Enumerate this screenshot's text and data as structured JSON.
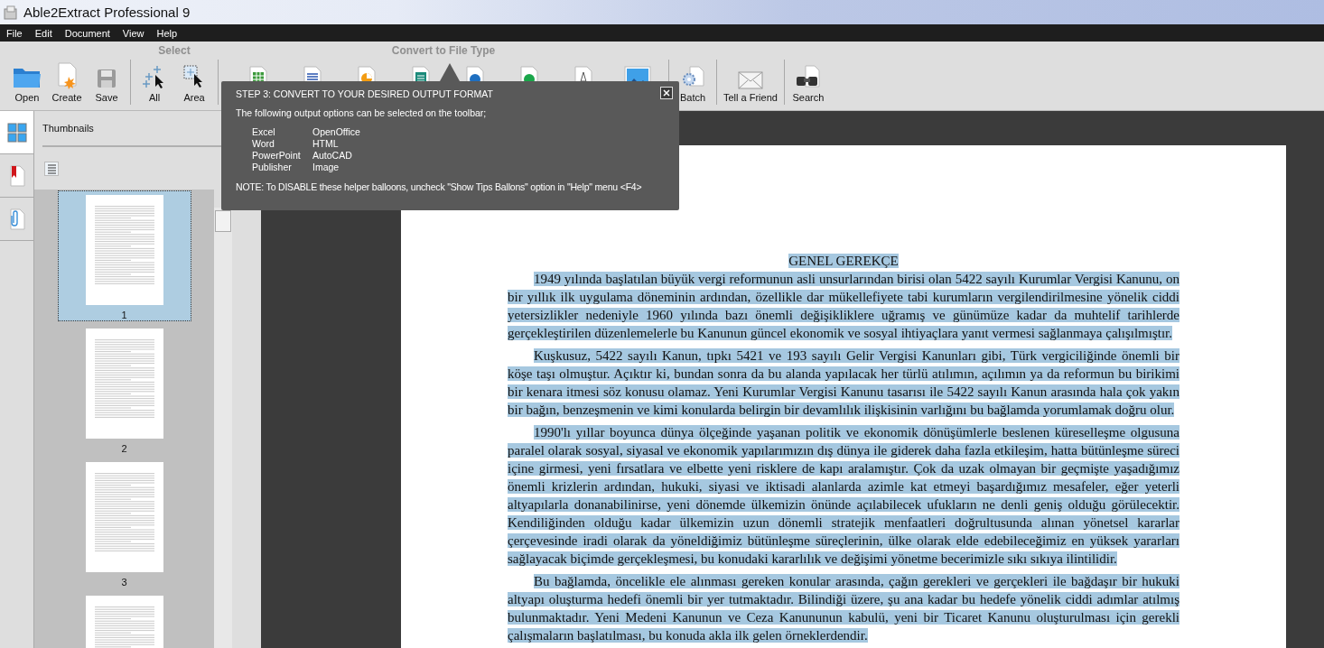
{
  "window": {
    "title": "Able2Extract Professional 9"
  },
  "menu": [
    "File",
    "Edit",
    "Document",
    "View",
    "Help"
  ],
  "toolbar": [
    {
      "buttons": [
        {
          "kind": "folder",
          "label": "Open"
        },
        {
          "kind": "create",
          "label": "Create"
        },
        {
          "kind": "save",
          "label": "Save"
        }
      ]
    },
    {
      "title": "Select",
      "buttons": [
        {
          "kind": "select-all",
          "label": "All"
        },
        {
          "kind": "select-area",
          "label": "Area"
        }
      ]
    },
    {
      "title": "Convert to File Type",
      "buttons": [
        {
          "kind": "sheet"
        },
        {
          "kind": "doc"
        },
        {
          "kind": "pie"
        },
        {
          "kind": "pub"
        },
        {
          "kind": "office"
        },
        {
          "kind": "html"
        },
        {
          "kind": "cad"
        },
        {
          "kind": "image"
        }
      ]
    },
    {
      "buttons": [
        {
          "kind": "batch",
          "label": "Batch"
        }
      ]
    },
    {
      "buttons": [
        {
          "kind": "mail",
          "label": "Tell a Friend"
        }
      ]
    },
    {
      "buttons": [
        {
          "kind": "binoculars",
          "label": "Search"
        }
      ]
    }
  ],
  "side_tabs": [
    {
      "kind": "thumbs",
      "selected": true
    },
    {
      "kind": "bookmark",
      "selected": false
    },
    {
      "kind": "attach",
      "selected": false
    }
  ],
  "thumbnails": {
    "title": "Thumbnails",
    "pages": [
      {
        "label": "1",
        "selected": true
      },
      {
        "label": "2",
        "selected": false
      },
      {
        "label": "3",
        "selected": false
      },
      {
        "selected": false
      }
    ]
  },
  "balloon": {
    "title": "STEP 3: CONVERT TO YOUR DESIRED OUTPUT FORMAT",
    "intro": "The following output options can be selected on the toolbar;",
    "options": [
      [
        "Excel",
        "OpenOffice"
      ],
      [
        "Word",
        "HTML"
      ],
      [
        "PowerPoint",
        "AutoCAD"
      ],
      [
        "Publisher",
        "Image"
      ]
    ],
    "note": "NOTE: To DISABLE these helper balloons, uncheck \"Show Tips Ballons\" option in \"Help\" menu <F4>"
  },
  "document": {
    "heading": "GENEL GEREKÇE",
    "paragraphs": [
      "1949 yılında başlatılan büyük vergi reformunun asli unsurlarından birisi olan 5422 sayılı Kurumlar Vergisi Kanunu, on bir yıllık ilk uygulama döneminin ardından, özellikle dar mükellefiyete tabi kurumların vergilendirilmesine yönelik ciddi yetersizlikler nedeniyle 1960 yılında bazı önemli değişikliklere uğramış ve günümüze kadar da muhtelif tarihlerde gerçekleştirilen düzenlemelerle bu Kanunun güncel ekonomik ve sosyal ihtiyaçlara yanıt vermesi sağlanmaya çalışılmıştır.",
      "Kuşkusuz, 5422 sayılı Kanun, tıpkı 5421 ve 193 sayılı Gelir Vergisi Kanunları gibi, Türk vergiciliğinde önemli bir köşe taşı olmuştur. Açıktır ki, bundan sonra da bu alanda yapılacak her türlü atılımın, açılımın ya da reformun bu birikimi bir kenara itmesi söz konusu olamaz. Yeni Kurumlar Vergisi Kanunu tasarısı ile 5422 sayılı Kanun arasında hala çok yakın bir bağın, benzeşmenin ve kimi konularda belirgin bir devamlılık ilişkisinin varlığını bu bağlamda yorumlamak doğru olur.",
      "1990'lı yıllar boyunca dünya ölçeğinde yaşanan politik ve ekonomik dönüşümlerle beslenen küreselleşme olgusuna paralel olarak sosyal, siyasal ve ekonomik yapılarımızın dış dünya ile giderek daha fazla etkileşim, hatta bütünleşme süreci içine girmesi, yeni fırsatlara ve elbette yeni risklere de kapı aralamıştır. Çok da uzak olmayan bir geçmişte yaşadığımız önemli krizlerin ardından, hukuki, siyasi ve iktisadi alanlarda azimle kat etmeyi başardığımız mesafeler, eğer yeterli altyapılarla donanabilinirse, yeni dönemde ülkemizin önünde açılabilecek ufukların ne denli geniş olduğu görülecektir. Kendiliğinden olduğu kadar ülkemizin uzun dönemli stratejik menfaatleri doğrultusunda alınan yönetsel kararlar çerçevesinde iradi olarak da yöneldiğimiz bütünleşme süreçlerinin, ülke olarak elde edebileceğimiz en yüksek yararları sağlayacak biçimde gerçekleşmesi, bu konudaki kararlılık ve değişimi yönetme becerimizle sıkı sıkıya ilintilidir.",
      "Bu bağlamda, öncelikle ele alınması gereken konular arasında, çağın gerekleri ve gerçekleri ile bağdaşır bir hukuki altyapı oluşturma hedefi önemli bir yer tutmaktadır. Bilindiği üzere, şu ana kadar bu hedefe yönelik ciddi adımlar atılmış bulunmaktadır. Yeni Medeni Kanunun ve Ceza Kanununun kabulü, yeni bir Ticaret Kanunu oluşturulması için gerekli çalışmaların başlatılması, bu konuda akla ilk gelen örneklerdendir."
    ]
  }
}
